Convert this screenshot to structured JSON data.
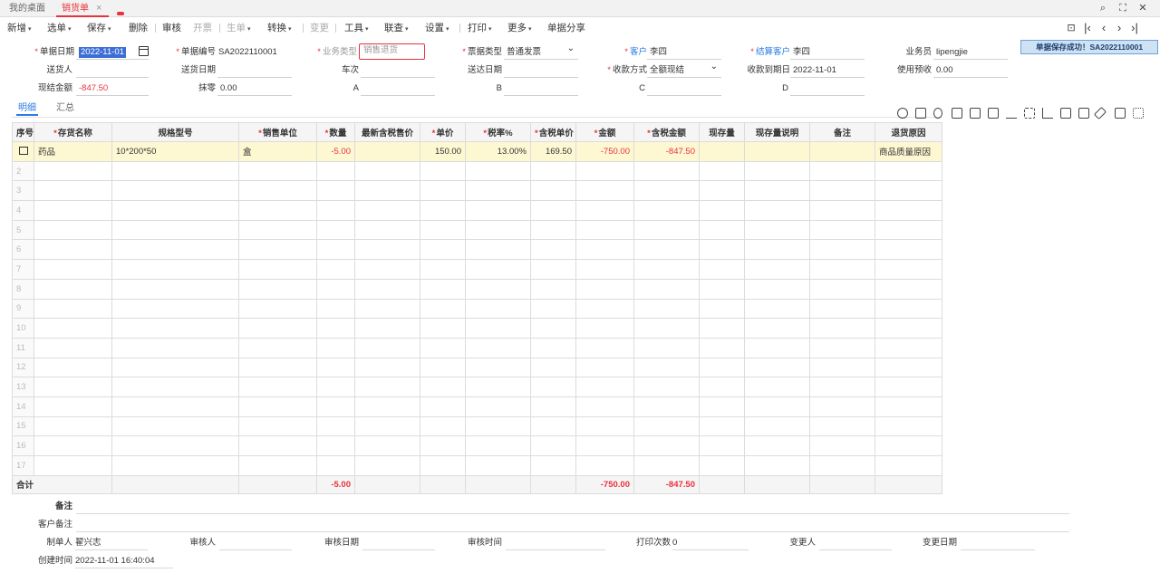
{
  "tabs": {
    "home": "我的桌面",
    "active": "销货单",
    "close": "×"
  },
  "toolbar": {
    "items": [
      "新增",
      "选单",
      "保存",
      "删除",
      "审核",
      "开票",
      "生单",
      "转换",
      "变更",
      "工具",
      "联查",
      "设置",
      "打印",
      "更多",
      "单据分享"
    ]
  },
  "header": {
    "doc_date_label": "单据日期",
    "doc_date": "2022-11-01",
    "doc_no_label": "单据编号",
    "doc_no": "SA2022110001",
    "bus_type_label": "业务类型",
    "bus_type": "销售退货",
    "bill_type_label": "票据类型",
    "bill_type": "普通发票",
    "customer_label": "客户",
    "customer": "李四",
    "settle_customer_label": "结算客户",
    "settle_customer": "李四",
    "salesman_label": "业务员",
    "salesman": "lipengjie",
    "deliverer_label": "送货人",
    "deliverer": "",
    "delivery_date_label": "送货日期",
    "delivery_date": "",
    "vehicle_label": "车次",
    "vehicle": "",
    "arrival_date_label": "送达日期",
    "arrival_date": "",
    "pay_method_label": "收款方式",
    "pay_method": "全额现结",
    "due_date_label": "收款到期日",
    "due_date": "2022-11-01",
    "use_advance_label": "使用预收",
    "use_advance": "0.00",
    "cash_amount_label": "现结金额",
    "cash_amount": "-847.50",
    "discount_label": "抹零",
    "discount": "0.00",
    "a_label": "A",
    "b_label": "B",
    "c_label": "C",
    "d_label": "D"
  },
  "toast": "单据保存成功！SA2022110001",
  "subtabs": {
    "detail": "明细",
    "summary": "汇总"
  },
  "grid": {
    "columns": [
      "序号",
      "存货名称",
      "规格型号",
      "销售单位",
      "数量",
      "最新含税售价",
      "单价",
      "税率%",
      "含税单价",
      "金额",
      "含税金额",
      "现存量",
      "现存量说明",
      "备注",
      "退货原因"
    ],
    "row1": {
      "name": "药品",
      "spec": "10*200*50",
      "unit": "盒",
      "qty": "-5.00",
      "price": "150.00",
      "tax_rate": "13.00%",
      "tax_price": "169.50",
      "amount": "-750.00",
      "tax_amount": "-847.50",
      "reason": "商品质量原因"
    },
    "row_numbers": [
      "2",
      "3",
      "4",
      "5",
      "6",
      "7",
      "8",
      "9",
      "10",
      "11",
      "12",
      "13",
      "14",
      "15",
      "16",
      "17"
    ],
    "total_label": "合计",
    "total_qty": "-5.00",
    "total_amount": "-750.00",
    "total_tax_amount": "-847.50"
  },
  "footer": {
    "remark_label": "备注",
    "cust_remark_label": "客户备注",
    "maker_label": "制单人",
    "maker": "翟兴志",
    "auditor_label": "审核人",
    "audit_date_label": "审核日期",
    "audit_time_label": "审核时间",
    "print_count_label": "打印次数",
    "print_count": "0",
    "changer_label": "变更人",
    "change_date_label": "变更日期",
    "created_label": "创建时间",
    "created": "2022-11-01 16:40:04"
  },
  "colors": {
    "accent": "#e8323c",
    "link": "#2c7be5",
    "selected_row": "#fdf7d2"
  }
}
